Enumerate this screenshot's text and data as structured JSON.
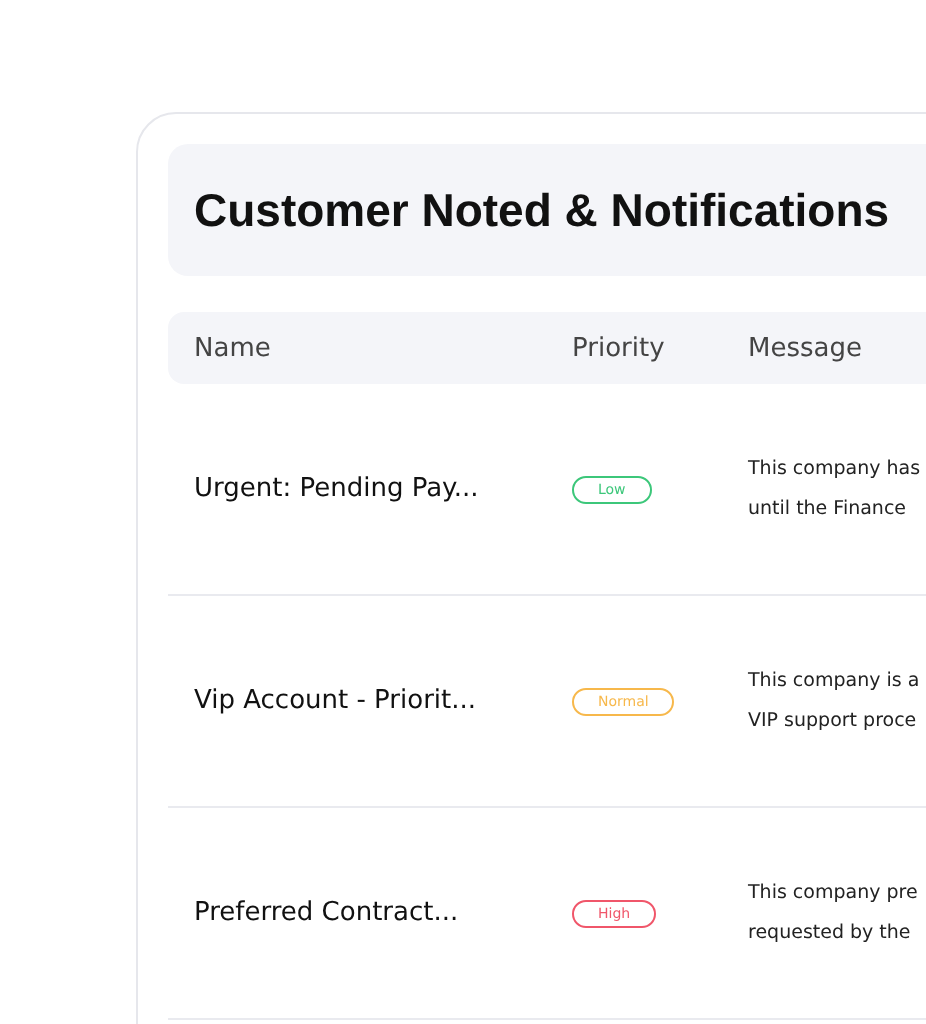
{
  "title": "Customer Noted & Notifications",
  "table": {
    "columns": [
      "Name",
      "Priority",
      "Message"
    ],
    "rows": [
      {
        "name": "Urgent: Pending Pay...",
        "priority": {
          "label": "Low",
          "color": "#3cc77a"
        },
        "message": [
          "This company has",
          "until the Finance"
        ]
      },
      {
        "name": "Vip Account - Priorit...",
        "priority": {
          "label": "Normal",
          "color": "#f7b84b"
        },
        "message": [
          "This company is a",
          "VIP support proce"
        ]
      },
      {
        "name": "Preferred Contract...",
        "priority": {
          "label": "High",
          "color": "#f0566a"
        },
        "message": [
          "This company pre",
          "requested by the"
        ]
      }
    ]
  }
}
